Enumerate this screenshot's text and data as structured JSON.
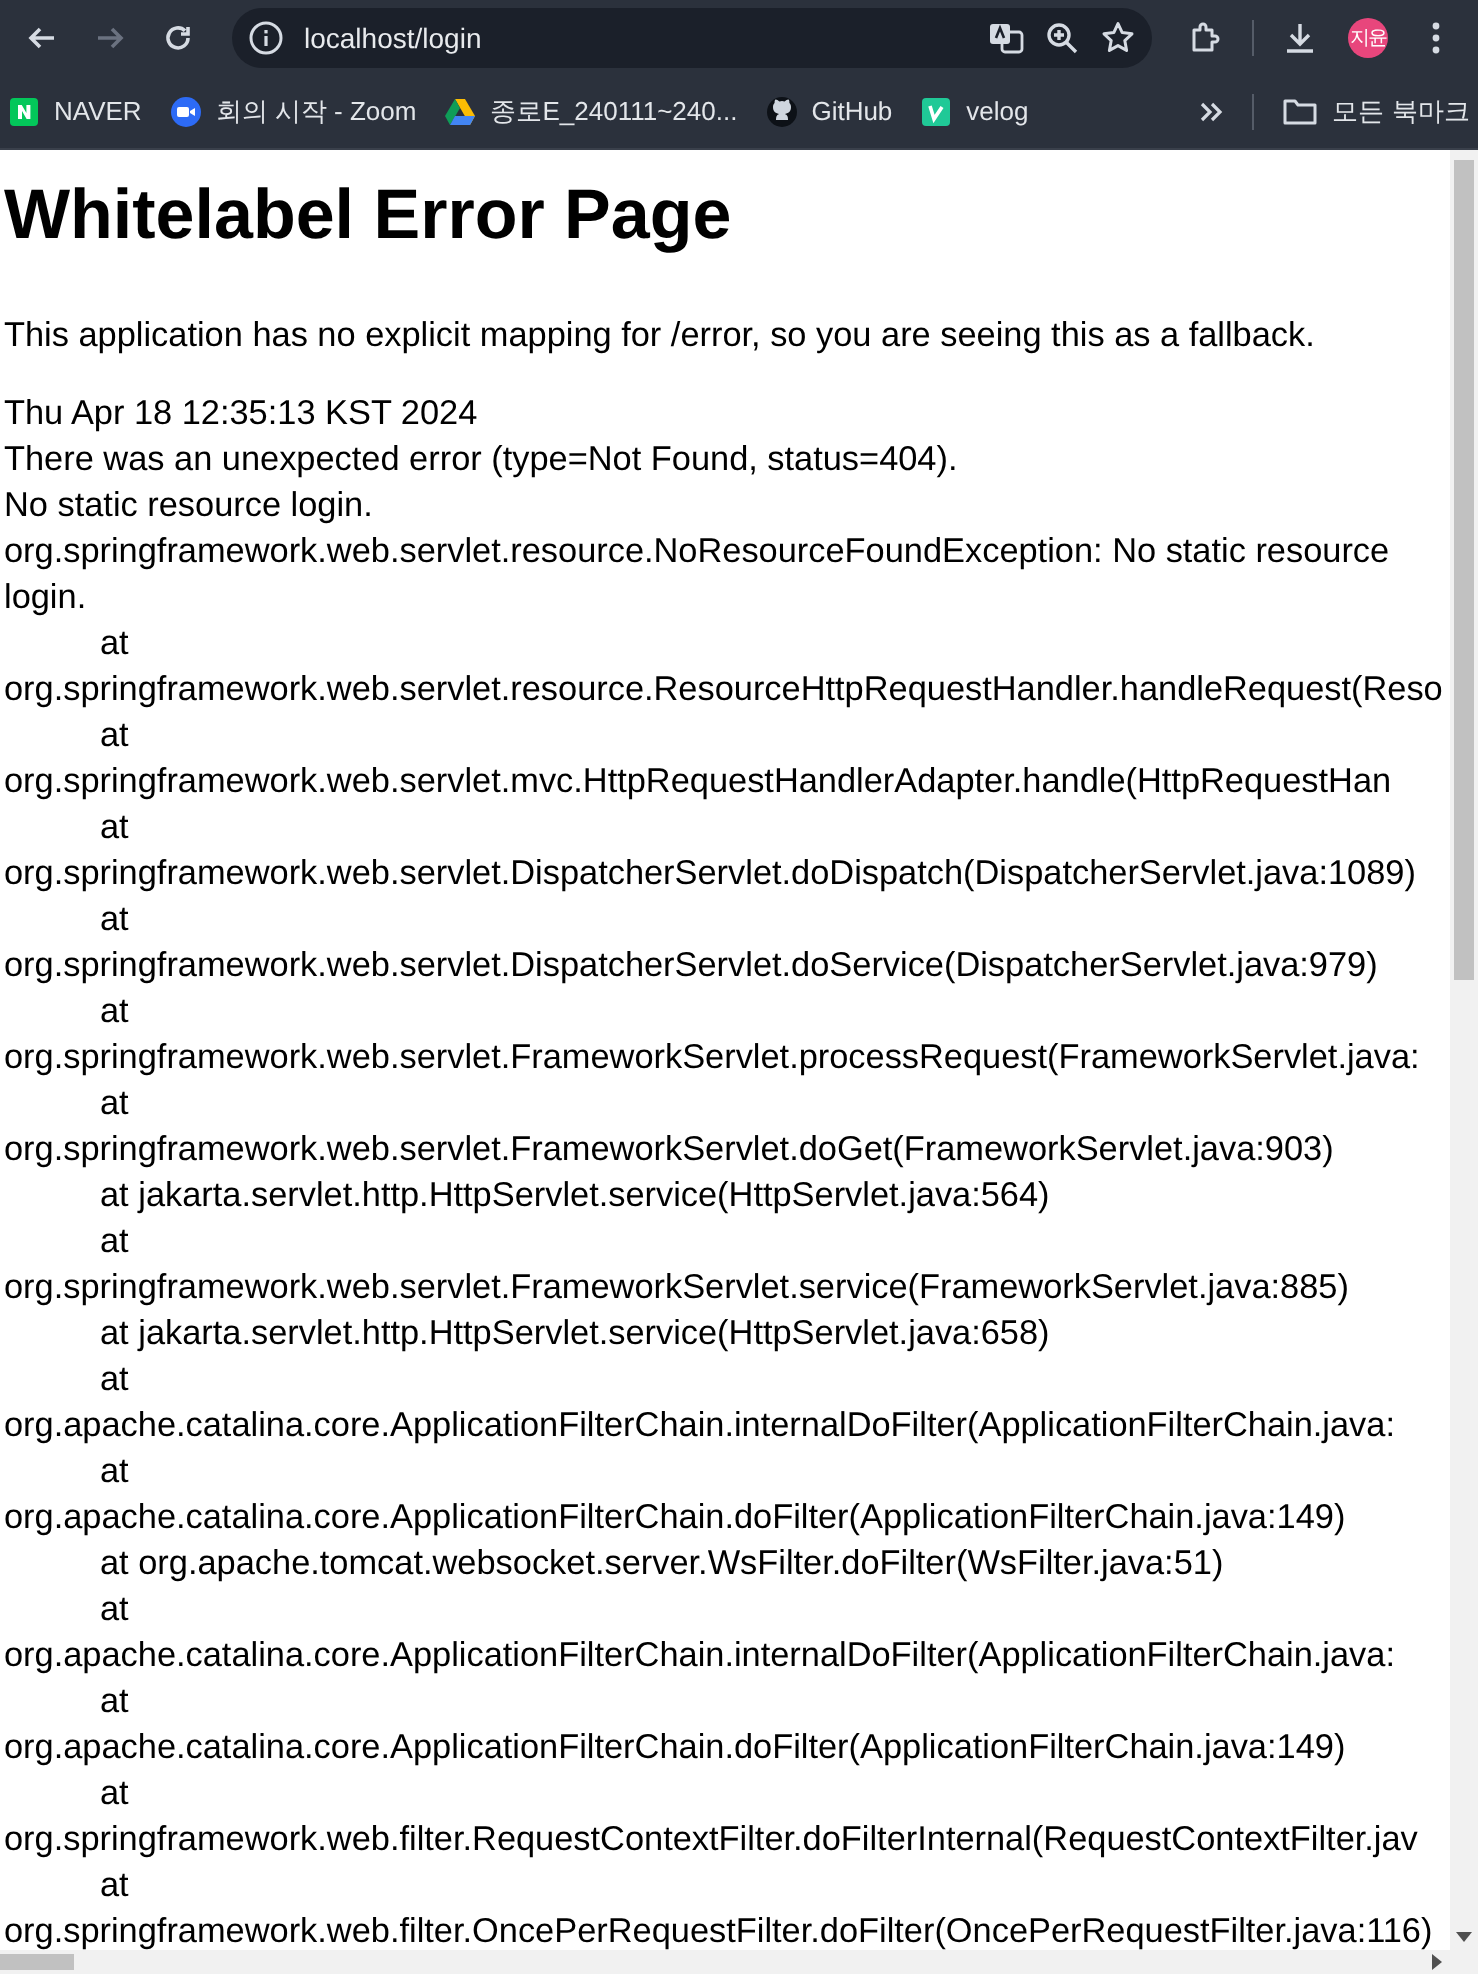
{
  "browser": {
    "back_disabled": false,
    "forward_disabled": true,
    "url": "localhost/login",
    "profile": "지윤"
  },
  "bookmarks": [
    {
      "label": "NAVER",
      "kind": "naver"
    },
    {
      "label": "회의 시작 - Zoom",
      "kind": "zoom"
    },
    {
      "label": "종로E_240111~240...",
      "kind": "drive"
    },
    {
      "label": "GitHub",
      "kind": "github"
    },
    {
      "label": "velog",
      "kind": "velog"
    }
  ],
  "all_bookmarks": "모든 북마크",
  "page": {
    "title": "Whitelabel Error Page",
    "message": "This application has no explicit mapping for /error, so you are seeing this as a fallback.",
    "timestamp": "Thu Apr 18 12:35:13 KST 2024",
    "error": "There was an unexpected error (type=Not Found, status=404).",
    "detail": "No static resource login.",
    "exception": "org.springframework.web.servlet.resource.NoResourceFoundException: No static resource login.",
    "frames": [
      {
        "kind": "wrapped",
        "at": "at",
        "call": "org.springframework.web.servlet.resource.ResourceHttpRequestHandler.handleRequest(Reso"
      },
      {
        "kind": "wrapped",
        "at": "at",
        "call": "org.springframework.web.servlet.mvc.HttpRequestHandlerAdapter.handle(HttpRequestHan"
      },
      {
        "kind": "wrapped",
        "at": "at",
        "call": "org.springframework.web.servlet.DispatcherServlet.doDispatch(DispatcherServlet.java:1089)"
      },
      {
        "kind": "wrapped",
        "at": "at",
        "call": "org.springframework.web.servlet.DispatcherServlet.doService(DispatcherServlet.java:979)"
      },
      {
        "kind": "wrapped",
        "at": "at",
        "call": "org.springframework.web.servlet.FrameworkServlet.processRequest(FrameworkServlet.java:"
      },
      {
        "kind": "wrapped",
        "at": "at",
        "call": "org.springframework.web.servlet.FrameworkServlet.doGet(FrameworkServlet.java:903)"
      },
      {
        "kind": "inline",
        "at": "at",
        "call": "jakarta.servlet.http.HttpServlet.service(HttpServlet.java:564)"
      },
      {
        "kind": "wrapped",
        "at": "at",
        "call": "org.springframework.web.servlet.FrameworkServlet.service(FrameworkServlet.java:885)"
      },
      {
        "kind": "inline",
        "at": "at",
        "call": "jakarta.servlet.http.HttpServlet.service(HttpServlet.java:658)"
      },
      {
        "kind": "wrapped",
        "at": "at",
        "call": "org.apache.catalina.core.ApplicationFilterChain.internalDoFilter(ApplicationFilterChain.java:"
      },
      {
        "kind": "wrapped",
        "at": "at",
        "call": "org.apache.catalina.core.ApplicationFilterChain.doFilter(ApplicationFilterChain.java:149)"
      },
      {
        "kind": "inline",
        "at": "at",
        "call": "org.apache.tomcat.websocket.server.WsFilter.doFilter(WsFilter.java:51)"
      },
      {
        "kind": "wrapped",
        "at": "at",
        "call": "org.apache.catalina.core.ApplicationFilterChain.internalDoFilter(ApplicationFilterChain.java:"
      },
      {
        "kind": "wrapped",
        "at": "at",
        "call": "org.apache.catalina.core.ApplicationFilterChain.doFilter(ApplicationFilterChain.java:149)"
      },
      {
        "kind": "wrapped",
        "at": "at",
        "call": "org.springframework.web.filter.RequestContextFilter.doFilterInternal(RequestContextFilter.jav"
      },
      {
        "kind": "wrapped",
        "at": "at",
        "call": "org.springframework.web.filter.OncePerRequestFilter.doFilter(OncePerRequestFilter.java:116)"
      }
    ]
  }
}
